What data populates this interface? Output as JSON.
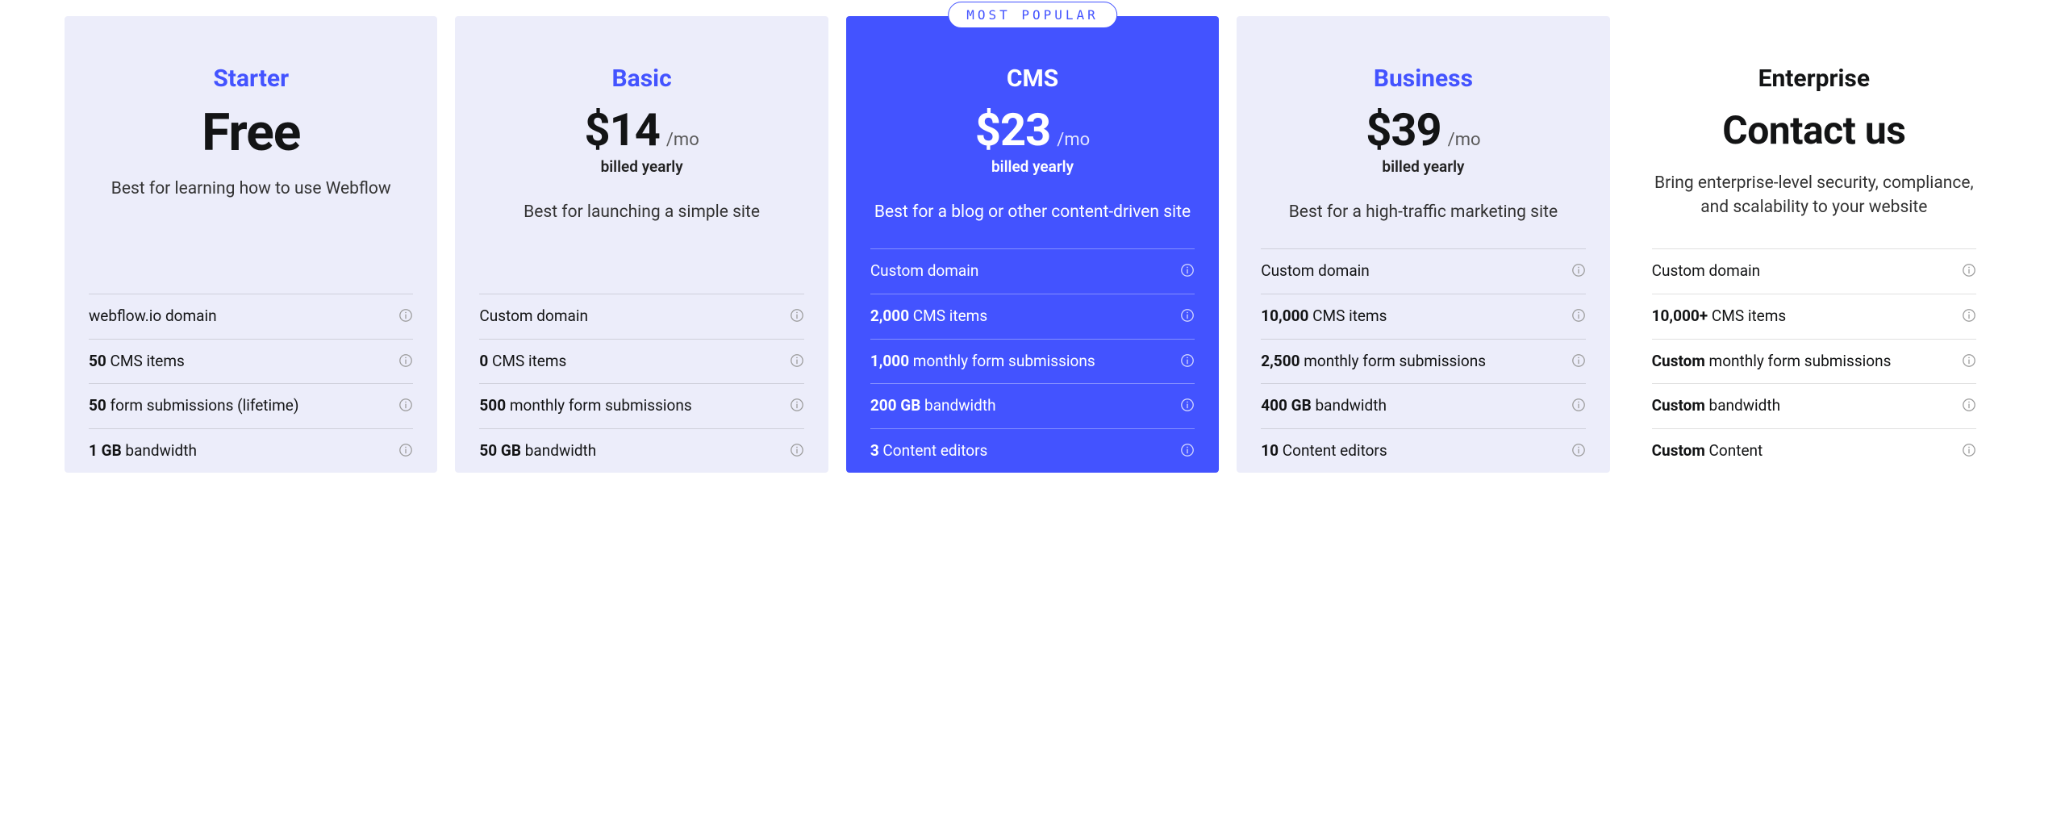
{
  "popular_badge": "MOST POPULAR",
  "plans": [
    {
      "name": "Starter",
      "price": "Free",
      "per": "",
      "billed": "",
      "desc": "Best for learning how to use Webflow",
      "variant": "light",
      "contact": false,
      "features": [
        {
          "bold": "",
          "text": "webflow.io domain"
        },
        {
          "bold": "50",
          "text": " CMS items"
        },
        {
          "bold": "50",
          "text": " form submissions (lifetime)"
        },
        {
          "bold": "1 GB",
          "text": " bandwidth"
        }
      ]
    },
    {
      "name": "Basic",
      "price": "$14",
      "per": "/mo",
      "billed": "billed yearly",
      "desc": "Best for launching a simple site",
      "variant": "light",
      "contact": false,
      "features": [
        {
          "bold": "",
          "text": "Custom domain"
        },
        {
          "bold": "0",
          "text": " CMS items"
        },
        {
          "bold": "500",
          "text": " monthly form submissions"
        },
        {
          "bold": "50 GB",
          "text": " bandwidth"
        }
      ]
    },
    {
      "name": "CMS",
      "price": "$23",
      "per": "/mo",
      "billed": "billed yearly",
      "desc": "Best for a blog or other content-driven site",
      "variant": "popular",
      "contact": false,
      "features": [
        {
          "bold": "",
          "text": "Custom domain"
        },
        {
          "bold": "2,000",
          "text": " CMS items"
        },
        {
          "bold": "1,000",
          "text": " monthly form submissions"
        },
        {
          "bold": "200 GB",
          "text": " bandwidth"
        },
        {
          "bold": "3",
          "text": " Content editors"
        }
      ]
    },
    {
      "name": "Business",
      "price": "$39",
      "per": "/mo",
      "billed": "billed yearly",
      "desc": "Best for a high-traffic marketing site",
      "variant": "light",
      "contact": false,
      "features": [
        {
          "bold": "",
          "text": "Custom domain"
        },
        {
          "bold": "10,000",
          "text": " CMS items"
        },
        {
          "bold": "2,500",
          "text": " monthly form submissions"
        },
        {
          "bold": "400 GB",
          "text": " bandwidth"
        },
        {
          "bold": "10",
          "text": " Content editors"
        }
      ]
    },
    {
      "name": "Enterprise",
      "price": "Contact us",
      "per": "",
      "billed": "",
      "desc": "Bring enterprise-level security, compliance, and scalability to your website",
      "variant": "enterprise",
      "contact": true,
      "features": [
        {
          "bold": "",
          "text": "Custom domain"
        },
        {
          "bold": "10,000+",
          "text": " CMS items"
        },
        {
          "bold": "Custom",
          "text": " monthly form submissions"
        },
        {
          "bold": "Custom",
          "text": " bandwidth"
        },
        {
          "bold": "Custom",
          "text": " Content"
        }
      ]
    }
  ]
}
